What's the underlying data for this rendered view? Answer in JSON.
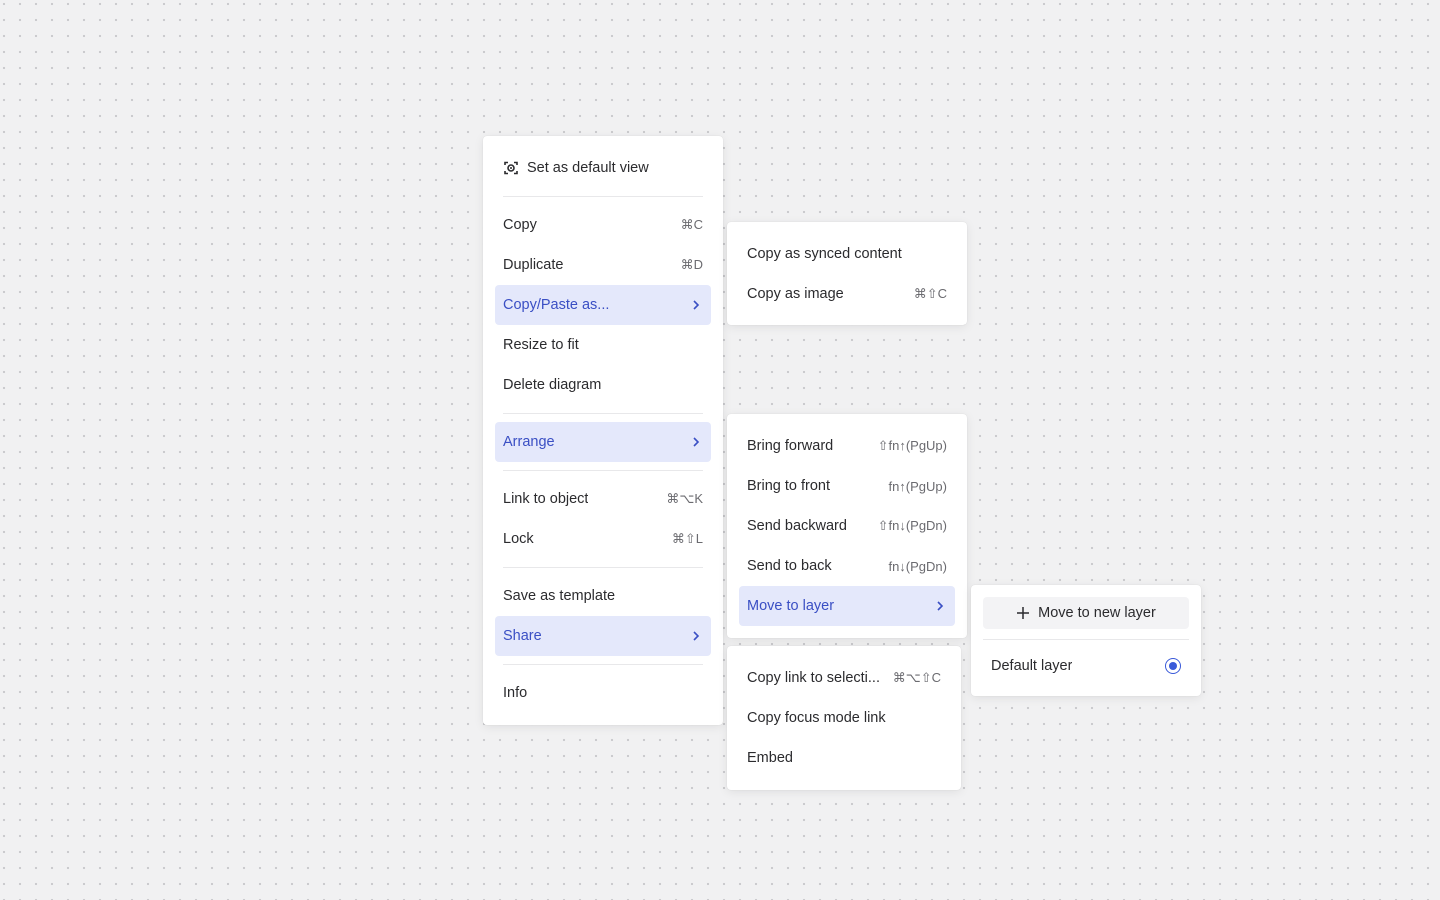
{
  "main_menu": {
    "set_default_view": "Set as default view",
    "copy": {
      "label": "Copy",
      "shortcut": "⌘C"
    },
    "duplicate": {
      "label": "Duplicate",
      "shortcut": "⌘D"
    },
    "copy_paste_as": {
      "label": "Copy/Paste as..."
    },
    "resize_to_fit": {
      "label": "Resize to fit"
    },
    "delete_diagram": {
      "label": "Delete diagram"
    },
    "arrange": {
      "label": "Arrange"
    },
    "link_to_object": {
      "label": "Link to object",
      "shortcut": "⌘⌥K"
    },
    "lock": {
      "label": "Lock",
      "shortcut": "⌘⇧L"
    },
    "save_as_template": {
      "label": "Save as template"
    },
    "share": {
      "label": "Share"
    },
    "info": {
      "label": "Info"
    }
  },
  "copy_paste_menu": {
    "synced": {
      "label": "Copy as synced content"
    },
    "image": {
      "label": "Copy as image",
      "shortcut": "⌘⇧C"
    }
  },
  "arrange_menu": {
    "bring_forward": {
      "label": "Bring forward",
      "shortcut": "⇧fn↑(PgUp)"
    },
    "bring_to_front": {
      "label": "Bring to front",
      "shortcut": "fn↑(PgUp)"
    },
    "send_backward": {
      "label": "Send backward",
      "shortcut": "⇧fn↓(PgDn)"
    },
    "send_to_back": {
      "label": "Send to back",
      "shortcut": "fn↓(PgDn)"
    },
    "move_to_layer": {
      "label": "Move to layer"
    }
  },
  "share_menu": {
    "copy_link": {
      "label": "Copy link to selecti...",
      "shortcut": "⌘⌥⇧C"
    },
    "focus_link": {
      "label": "Copy focus mode link"
    },
    "embed": {
      "label": "Embed"
    }
  },
  "layer_menu": {
    "new_layer": "Move to new layer",
    "default_layer": {
      "label": "Default layer",
      "selected": true
    }
  },
  "colors": {
    "accent": "#3a4fc4",
    "active_bg": "#e4e8fb",
    "radio": "#3a5ad9",
    "canvas_bg": "#f1f1f2"
  },
  "icons": {
    "default_view": "viewfinder-icon",
    "submenu": "chevron-right-icon",
    "new_layer": "plus-icon",
    "selected": "radio-selected-icon"
  }
}
